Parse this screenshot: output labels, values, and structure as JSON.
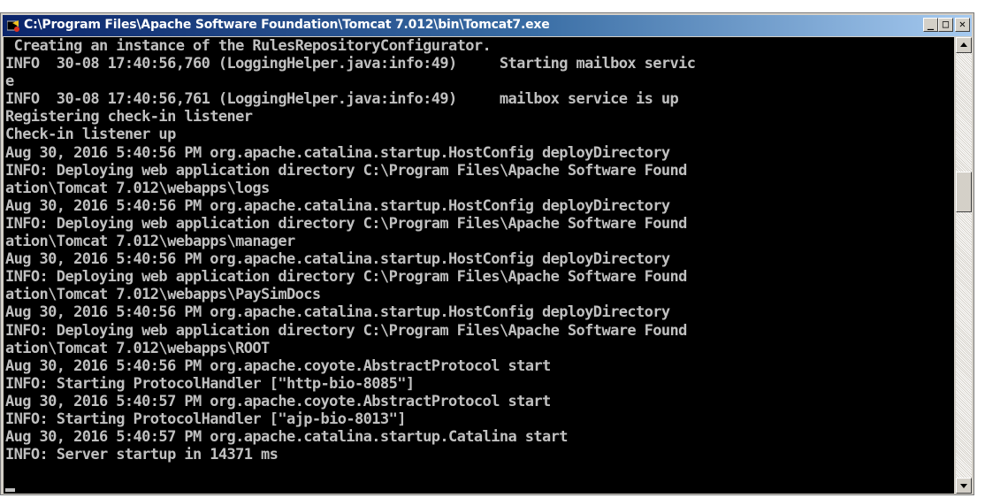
{
  "window": {
    "title": "C:\\Program Files\\Apache Software Foundation\\Tomcat 7.012\\bin\\Tomcat7.exe",
    "minimize_label": "_",
    "maximize_label": "□",
    "close_label": "✕",
    "app_icon": "tomcat-console-icon"
  },
  "console": {
    "output": " Creating an instance of the RulesRepositoryConfigurator.\nINFO  30-08 17:40:56,760 (LoggingHelper.java:info:49)     Starting mailbox servic\ne\nINFO  30-08 17:40:56,761 (LoggingHelper.java:info:49)     mailbox service is up\nRegistering check-in listener\nCheck-in listener up\nAug 30, 2016 5:40:56 PM org.apache.catalina.startup.HostConfig deployDirectory\nINFO: Deploying web application directory C:\\Program Files\\Apache Software Found\nation\\Tomcat 7.012\\webapps\\logs\nAug 30, 2016 5:40:56 PM org.apache.catalina.startup.HostConfig deployDirectory\nINFO: Deploying web application directory C:\\Program Files\\Apache Software Found\nation\\Tomcat 7.012\\webapps\\manager\nAug 30, 2016 5:40:56 PM org.apache.catalina.startup.HostConfig deployDirectory\nINFO: Deploying web application directory C:\\Program Files\\Apache Software Found\nation\\Tomcat 7.012\\webapps\\PaySimDocs\nAug 30, 2016 5:40:56 PM org.apache.catalina.startup.HostConfig deployDirectory\nINFO: Deploying web application directory C:\\Program Files\\Apache Software Found\nation\\Tomcat 7.012\\webapps\\ROOT\nAug 30, 2016 5:40:56 PM org.apache.coyote.AbstractProtocol start\nINFO: Starting ProtocolHandler [\"http-bio-8085\"]\nAug 30, 2016 5:40:57 PM org.apache.coyote.AbstractProtocol start\nINFO: Starting ProtocolHandler [\"ajp-bio-8013\"]\nAug 30, 2016 5:40:57 PM org.apache.catalina.startup.Catalina start\nINFO: Server startup in 14371 ms"
  },
  "colors": {
    "console_background": "#000000",
    "console_text": "#c0c0c0",
    "titlebar_start": "#0a246a",
    "titlebar_end": "#a6caf0"
  }
}
